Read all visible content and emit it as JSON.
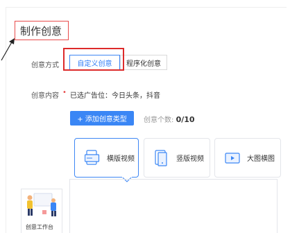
{
  "page": {
    "title": "制作创意"
  },
  "creative_mode": {
    "label": "创意方式",
    "options": [
      {
        "label": "自定义创意",
        "selected": true
      },
      {
        "label": "程序化创意",
        "selected": false
      }
    ]
  },
  "creative_content": {
    "label": "创意内容",
    "required_mark": "•",
    "selected_slots": "已选广告位：今日头条，抖音"
  },
  "add_button": {
    "label": "+ 添加创意类型"
  },
  "creative_count": {
    "label": "创意个数:",
    "value": "0/10"
  },
  "creative_types": [
    {
      "label": "横版视频",
      "icon": "horizontal-video-icon",
      "selected": true
    },
    {
      "label": "竖版视频",
      "icon": "vertical-video-icon",
      "selected": false
    },
    {
      "label": "大图横图",
      "icon": "large-image-icon",
      "selected": false
    }
  ],
  "workbench": {
    "label": "创意工作台"
  },
  "colors": {
    "accent": "#3a86f5",
    "highlight_red": "#dd2a2a"
  }
}
